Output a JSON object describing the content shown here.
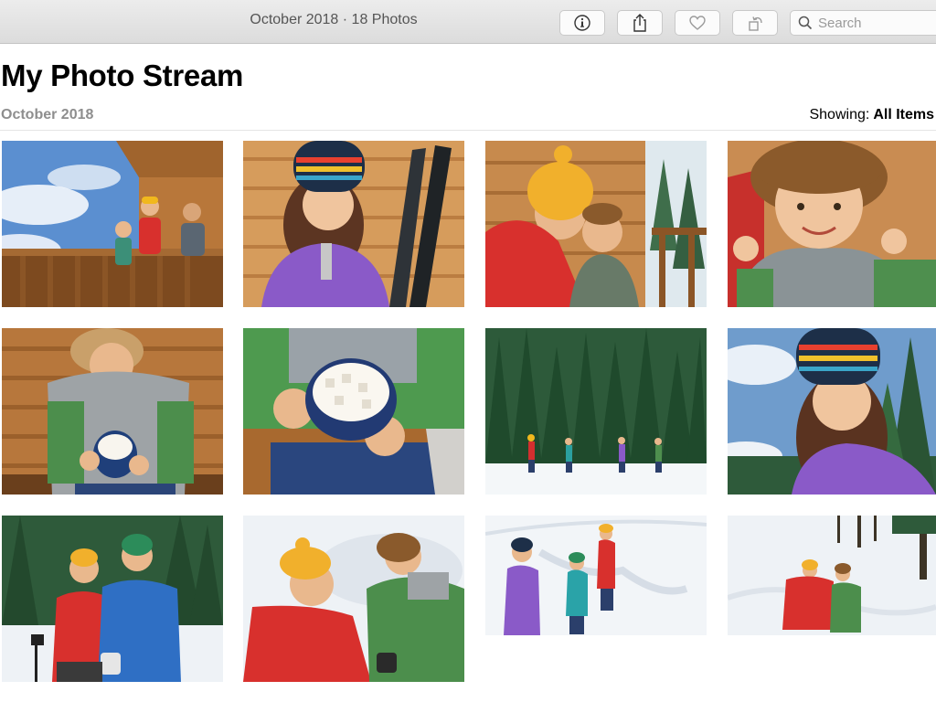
{
  "toolbar": {
    "title": "October 2018 · 18 Photos",
    "buttons": [
      {
        "icon": "info-icon",
        "label": "Info"
      },
      {
        "icon": "share-icon",
        "label": "Share"
      },
      {
        "icon": "heart-icon",
        "label": "Favorite"
      },
      {
        "icon": "rotate-icon",
        "label": "Rotate"
      }
    ],
    "search": {
      "placeholder": "Search",
      "value": ""
    }
  },
  "header": {
    "title": "My Photo Stream",
    "subtitle": "October 2018",
    "showing_label": "Showing:",
    "showing_value": "All Items"
  },
  "colors": {
    "toolbar_bg": "#dcdcdc",
    "title_text": "#000000",
    "subtitle_text": "#8e8e8e"
  },
  "photos": [
    {
      "scene": "family on log cabin deck under blue sky"
    },
    {
      "scene": "girl in striped beanie with skis by log wall"
    },
    {
      "scene": "mother in yellow hat hugging boy"
    },
    {
      "scene": "curly haired boy smiling close-up"
    },
    {
      "scene": "boy holding mug of marshmallows"
    },
    {
      "scene": "hands holding blue mug of marshmallows"
    },
    {
      "scene": "skiers in snowy pine forest"
    },
    {
      "scene": "girl in striped beanie in forest"
    },
    {
      "scene": "couple in winter jackets in forest"
    },
    {
      "scene": "mother and son lying in snow"
    },
    {
      "scene": "family snowshoeing on trail"
    },
    {
      "scene": "mother and child walking in snow"
    }
  ]
}
